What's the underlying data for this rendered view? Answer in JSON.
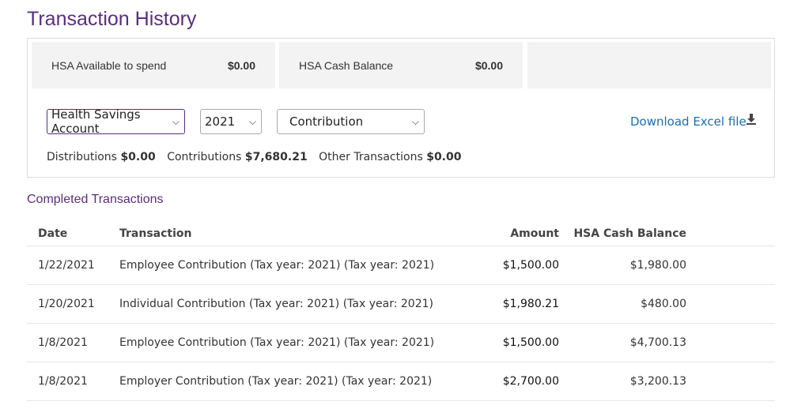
{
  "page": {
    "title": "Transaction History"
  },
  "balances": {
    "available_label": "HSA Available to spend",
    "available_value": "$0.00",
    "cash_label": "HSA Cash Balance",
    "cash_value": "$0.00"
  },
  "filters": {
    "account": "Health Savings Account",
    "year": "2021",
    "type": "Contribution"
  },
  "download": {
    "label": "Download Excel file"
  },
  "summary": {
    "distributions_label": "Distributions",
    "distributions_value": "$0.00",
    "contributions_label": "Contributions",
    "contributions_value": "$7,680.21",
    "other_label": "Other Transactions",
    "other_value": "$0.00"
  },
  "completed": {
    "title": "Completed Transactions",
    "columns": {
      "date": "Date",
      "transaction": "Transaction",
      "amount": "Amount",
      "balance": "HSA Cash Balance"
    },
    "rows": [
      {
        "date": "1/22/2021",
        "transaction": "Employee Contribution (Tax year: 2021) (Tax year: 2021)",
        "amount": "$1,500.00",
        "balance": "$1,980.00"
      },
      {
        "date": "1/20/2021",
        "transaction": "Individual Contribution (Tax year: 2021) (Tax year: 2021)",
        "amount": "$1,980.21",
        "balance": "$480.00"
      },
      {
        "date": "1/8/2021",
        "transaction": "Employee Contribution (Tax year: 2021) (Tax year: 2021)",
        "amount": "$1,500.00",
        "balance": "$4,700.13"
      },
      {
        "date": "1/8/2021",
        "transaction": "Employer Contribution (Tax year: 2021) (Tax year: 2021)",
        "amount": "$2,700.00",
        "balance": "$3,200.13"
      }
    ]
  },
  "colors": {
    "brand": "#5a2d81",
    "link": "#1a6fb0",
    "tile_bg": "#f3f3f3"
  },
  "icons": {
    "download": "download-icon",
    "chevron": "chevron-down-icon"
  }
}
